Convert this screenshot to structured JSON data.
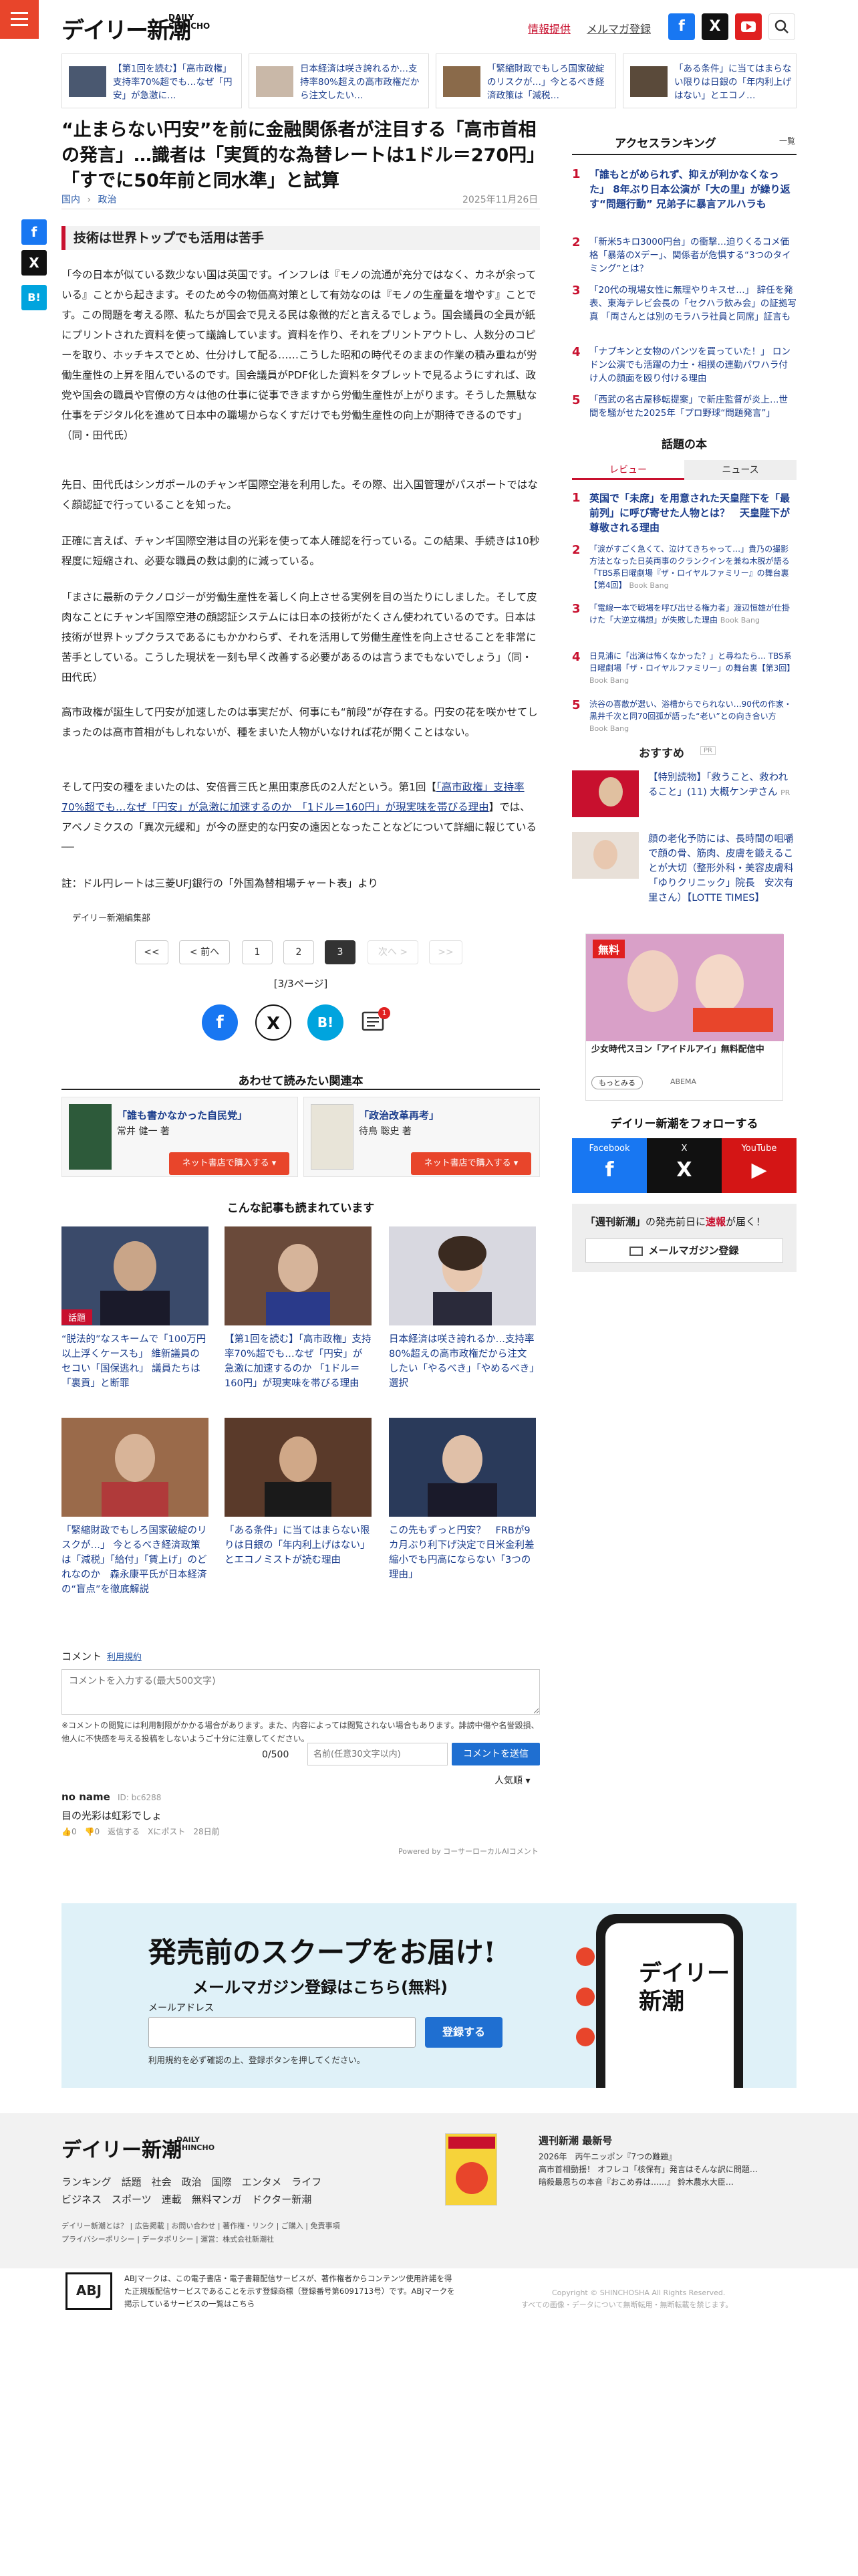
{
  "header": {
    "logo_jp": "デイリー新潮",
    "logo_en_1": "DAILY",
    "logo_en_2": "SHINCHO",
    "link_info": "情報提供",
    "link_mail": "メルマガ登録",
    "fb": "f",
    "x": "X"
  },
  "top_related": [
    "【第1回を読む】「高市政権」支持率70%超でも…なぜ「円安」が急激に…",
    "日本経済は咲き誇れるか…支持率80%超えの高市政権だから注文したい…",
    "「緊縮財政でもしろ国家破綻のリスクが…」今とるべき経済政策は「減税…",
    "「ある条件」に当てはまらない限りは日銀の「年内利上げはない」とエコノ…"
  ],
  "article": {
    "title": "“止まらない円安”を前に金融関係者が注目する「高市首相の発言」…識者は「実質的な為替レートは1ドル＝270円」「すでに50年前と同水準」と試算",
    "crumb_home": "国内",
    "crumb_sep": "›",
    "crumb_cat": "政治",
    "date": "2025年11月26日",
    "subheading": "技術は世界トップでも活用は苦手",
    "p1": "「今の日本が似ている数少ない国は英国です。インフレは『モノの流通が充分ではなく、カネが余っている』ことから起きます。そのため今の物価高対策として有効なのは『モノの生産量を増やす』ことです。この問題を考える際、私たちが国会で見える民は象徴的だと言えるでしょう。国会議員の全員が紙にプリントされた資料を使って議論しています。資料を作り、それをプリントアウトし、人数分のコピーを取り、ホッチキスでとめ、仕分けして配る……こうした昭和の時代そのままの作業の積み重ねが労働生産性の上昇を阻んでいるのです。国会議員がPDF化した資料をタブレットで見るようにすれば、政党や国会の職員や官僚の方々は他の仕事に従事できますから労働生産性が上がります。そうした無駄な仕事をデジタル化を進めて日本中の職場からなくすだけでも労働生産性の向上が期待できるのです」（同・田代氏）",
    "p2": "先日、田代氏はシンガポールのチャンギ国際空港を利用した。その際、出入国管理がパスポートではなく顔認証で行っていることを知った。",
    "p3": "正確に言えば、チャンギ国際空港は目の光彩を使って本人確認を行っている。この結果、手続きは10秒程度に短縮され、必要な職員の数は劇的に減っている。",
    "p4": "「まさに最新のテクノロジーが労働生産性を著しく向上させる実例を目の当たりにしました。そして皮肉なことにチャンギ国際空港の顔認証システムには日本の技術がたくさん使われているのです。日本は技術が世界トップクラスであるにもかかわらず、それを活用して労働生産性を向上させることを非常に苦手としている。こうした現状を一刻も早く改善する必要があるのは言うまでもないでしょう」（同・田代氏）",
    "p5": "高市政権が誕生して円安が加速したのは事実だが、何事にも“前段”が存在する。円安の花を咲かせてしまったのは高市首相がもしれないが、種をまいた人物がいなければ花が開くことはない。",
    "p6_a": "そして円安の種をまいたのは、安倍晋三氏と黒田東彦氏の2人だという。第1回【",
    "p6_link": "「高市政権」支持率70%超でも…なぜ「円安」が急激に加速するのか　「1ドル＝160円」が現実味を帯びる理由",
    "p6_b": "】では、アベノミクスの「異次元緩和」が今の歴史的な円安の遠因となったことなどについて詳細に報じている──",
    "note": "註：ドル円レートは三菱UFJ銀行の「外国為替相場チャート表」より",
    "editorial": "デイリー新潮編集部"
  },
  "share_side": {
    "fb": "f",
    "x": "X",
    "hatena": "B!"
  },
  "pager": {
    "first": "<<",
    "prev": "< 前へ",
    "p1": "1",
    "p2": "2",
    "p3": "3",
    "next": "次へ >",
    "last": ">>",
    "count": "[3/3ページ]"
  },
  "share_bottom": {
    "fb": "f",
    "x": "X",
    "hatena": "B!",
    "comment_badge": "1"
  },
  "books": {
    "heading": "あわせて読みたい関連本",
    "items": [
      {
        "title": "「誰も書かなかった自民党」",
        "author": "常井 健一 著",
        "buy": "ネット書店で購入する ▾"
      },
      {
        "title": "「政治改革再考」",
        "author": "待鳥 聡史 著",
        "buy": "ネット書店で購入する ▾"
      }
    ]
  },
  "more": {
    "heading": "こんな記事も読まれています",
    "badge": "話題",
    "items": [
      "“脱法的”なスキームで「100万円以上浮くケースも」 維新議員のセコい「国保逃れ」 議員たちは「裏貢」と断罪",
      "【第1回を読む】「高市政権」支持率70%超でも…なぜ「円安」が急激に加速するのか 「1ドル＝160円」が現実味を帯びる理由",
      "日本経済は咲き誇れるか…支持率80%超えの高市政権だから注文したい「やるべき」「やめるべき」選択",
      "「緊縮財政でもしろ国家破綻のリスクが…」 今とるべき経済政策は「減税」「給付」「賃上げ」のどれなのか　森永康平氏が日本経済の“盲点”を徹底解説",
      "「ある条件」に当てはまらない限りは日銀の「年内利上げはない」とエコノミストが読む理由",
      "この先もずっと円安？　FRBが9カ月ぶり利下げ決定で日米金利差縮小でも円高にならない「3つの理由」"
    ]
  },
  "comments": {
    "label": "コメント",
    "rules": "利用規約",
    "placeholder": "コメントを入力する(最大500文字)",
    "note": "※コメントの閲覧には利用制限がかかる場合があります。また、内容によっては閲覧されない場合もあります。誹謗中傷や名誉毀損、他人に不快感を与える投稿をしないようご十分に注意してください。",
    "counter": "0/500",
    "name_placeholder": "名前(任意30文字以内)",
    "send": "コメントを送信",
    "sort": "人気順 ▾",
    "user": "no name",
    "uid": "ID: bc6288",
    "body": "目の光彩は虹彩でしょ",
    "meta": "👍0　👎0　返信する　Xにポスト　28日前",
    "powered": "Powered by コーサーローカルAIコメント"
  },
  "newsletter": {
    "headline": "発売前のスクープをお届け!",
    "subheadline": "メールマガジン登録はこちら(無料)",
    "label": "メールアドレス",
    "button": "登録する",
    "note": "利用規約を必ず確認の上、登録ボタンを押してください。",
    "phone_logo_1": "デイリー",
    "phone_logo_2": "新潮"
  },
  "footer": {
    "logo_jp": "デイリー新潮",
    "logo_en_1": "DAILY",
    "logo_en_2": "SHINCHO",
    "row1": [
      "ランキング",
      "話題",
      "社会",
      "政治",
      "国際",
      "エンタメ",
      "ライフ"
    ],
    "row2": [
      "ビジネス",
      "スポーツ",
      "連載",
      "無料マンガ",
      "ドクター新潮"
    ],
    "small1": "デイリー新潮とは？ | 広告掲載 | お問い合わせ | 著作権・リンク | ご購入 | 免責事項",
    "small2": "プライバシーポリシー | データポリシー | 運営：株式会社新潮社",
    "mag_title": "週刊新潮 最新号",
    "mag_items": [
      "2026年　丙午ニッポン『7つの難題』",
      "高市首相動揺！ オフレコ「核保有」発言はそんな訳に問題…",
      "暗殺最恩ちの本音『おこめ券は……』 鈴木農水大臣…"
    ],
    "abj": "ABJマークは、この電子書店・電子書籍配信サービスが、著作権者からコンテンツ使用許諾を得た正規版配信サービスであることを示す登録商標（登録番号第6091713号）です。ABJマークを掲示しているサービスの一覧はこちら",
    "copyright": "Copyright © SHINCHOSHA All Rights Reserved.",
    "copyright2": "すべての画像・データについて無断転用・無断転載を禁じます。"
  },
  "sidebar": {
    "ranking_heading": "アクセスランキング",
    "ranking_more": "一覧",
    "ranking": [
      {
        "n": "1",
        "t": "「誰もとがめられず、抑えが利かなくなった」 8年ぶり日本公演が「大の里」が繰り返す“問題行動” 兄弟子に暴言アルハラも"
      },
      {
        "n": "2",
        "t": "「新米5キロ3000円台」の衝撃…迫りくるコメ価格「暴落のXデー」、関係者が危惧する“3つのタイミング”とは？"
      },
      {
        "n": "3",
        "t": "「20代の現場女性に無理やりキスせ…」 辞任を発表、東海テレビ会長の「セクハラ飲み会」の証拠写真 「両さんとは別のモラハラ社員と同席」証言も"
      },
      {
        "n": "4",
        "t": "「ナプキンと女物のパンツを買っていた！」 ロンドン公演でも活躍の力士・相撲の連勤パワハラ付け人の顔面を殴り付ける理由"
      },
      {
        "n": "5",
        "t": "「西武の名古屋移転提案」で新庄監督が炎上…世間を騒がせた2025年「プロ野球“問題発言”」"
      }
    ],
    "books_heading": "話題の本",
    "tab_review": "レビュー",
    "tab_news": "ニュース",
    "books": [
      {
        "n": "1",
        "t": "英国で「未席」を用意された天皇陛下を「最前列」に呼び寄せた人物とは？　天皇陛下が尊敬される理由",
        "s": ""
      },
      {
        "n": "2",
        "t": "「涙がすごく急くて、泣けてきちゃって…」貴乃の撮影方法となった日英両事のクランクインを兼ね木脱が語る「TBS系日曜劇場『ザ・ロイヤルファミリー』の舞台裏【第4回】",
        "s": "Book Bang"
      },
      {
        "n": "3",
        "t": "「電線一本で戦場を呼び出せる権力者」渡辺恒雄が仕掛けた「大逆立構想」が失敗した理由",
        "s": "Book Bang"
      },
      {
        "n": "4",
        "t": "日見浦に「出演は怖くなかった？」と尋ねたら… TBS系日曜劇場「ザ・ロイヤルファミリー」の舞台裏【第3回】",
        "s": "Book Bang"
      },
      {
        "n": "5",
        "t": "渋谷の喜散が選い、浴槽からでられない…90代の作家・黒井千次と同70回孤が語った“老い”との向き合い方",
        "s": "Book Bang"
      }
    ],
    "rec_heading": "おすすめ",
    "rec_pr": "PR",
    "rec": [
      {
        "t": "【特別読物】「救うこと、救われること」(11) 大概ケンヂさん",
        "s": "PR"
      },
      {
        "t": "顔の老化予防には、長時間の咀嚼で顔の骨、筋肉、皮膚を鍛えることが大切（整形外科・美容皮膚科「ゆりクリニック」院長　安次有里さん）【LOTTE TIMES】",
        "s": ""
      }
    ],
    "ad_free": "無料",
    "ad_title": "少女時代スヨン「アイドルアイ」無料配信中",
    "ad_btn": "もっとみる",
    "ad_brand": "ABEMA",
    "follow_heading": "デイリー新潮をフォローする",
    "follow": [
      {
        "label": "Facebook",
        "glyph": "f"
      },
      {
        "label": "X",
        "glyph": "X"
      },
      {
        "label": "YouTube",
        "glyph": "▶"
      }
    ],
    "mail_promo_a": "「週刊新潮」",
    "mail_promo_b": "の発売前日に",
    "mail_promo_c": "速報",
    "mail_promo_d": "が届く！",
    "mail_btn": "メールマガジン登録"
  }
}
